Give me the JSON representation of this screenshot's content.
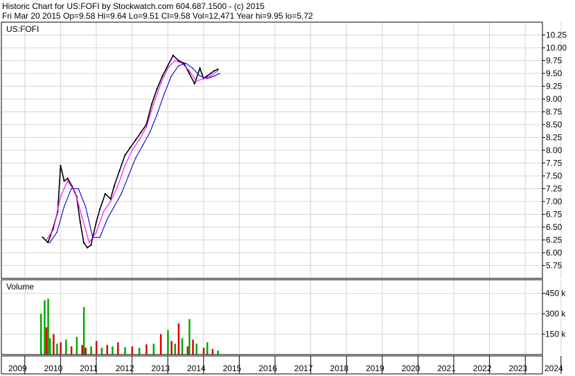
{
  "header": {
    "line1": "Historic Chart for US:FOFI by Stockwatch.com 604.687.1500 - (c) 2015",
    "line2": "Fri Mar 20 2015   Op=9.58  Hi=9.64  Lo=9.51  Cl=9.58  Vol=12,471  Year hi=9.95  lo=5.72"
  },
  "chart_data": [
    {
      "type": "line",
      "title": "US:FOFI",
      "x_years": [
        "2009",
        "2010",
        "2011",
        "2012",
        "2013",
        "2014",
        "2015",
        "2016",
        "2017",
        "2018",
        "2019",
        "2020",
        "2021",
        "2022",
        "2023",
        "2024"
      ],
      "y_ticks": [
        5.75,
        6.0,
        6.25,
        6.5,
        6.75,
        7.0,
        7.25,
        7.5,
        7.75,
        8.0,
        8.25,
        8.5,
        8.75,
        9.0,
        9.25,
        9.5,
        9.75,
        10.0,
        10.25
      ],
      "ylim": [
        5.5,
        10.5
      ],
      "series": [
        {
          "color": "#000000",
          "x": [
            2010.0,
            2010.15,
            2010.3,
            2010.42,
            2010.5,
            2010.6,
            2010.7,
            2010.82,
            2010.95,
            2011.05,
            2011.15,
            2011.25,
            2011.35,
            2011.5,
            2011.6,
            2011.75,
            2011.9,
            2012.0,
            2012.15,
            2012.3,
            2012.45,
            2012.6,
            2012.75,
            2012.9,
            2013.05,
            2013.2,
            2013.35,
            2013.5,
            2013.65,
            2013.8,
            2013.95,
            2014.1,
            2014.25,
            2014.4,
            2014.5,
            2014.6,
            2014.7,
            2014.8,
            2014.9
          ],
          "values": [
            6.3,
            6.2,
            6.5,
            6.8,
            7.7,
            7.4,
            7.45,
            7.3,
            7.1,
            6.6,
            6.2,
            6.1,
            6.15,
            6.6,
            6.85,
            7.15,
            7.05,
            7.3,
            7.6,
            7.9,
            8.05,
            8.2,
            8.35,
            8.5,
            8.9,
            9.2,
            9.45,
            9.65,
            9.85,
            9.75,
            9.7,
            9.5,
            9.3,
            9.6,
            9.4,
            9.45,
            9.5,
            9.55,
            9.58
          ]
        },
        {
          "color": "#ff00ff",
          "x": [
            2010.1,
            2010.3,
            2010.5,
            2010.7,
            2010.9,
            2011.1,
            2011.3,
            2011.5,
            2011.7,
            2011.9,
            2012.1,
            2012.3,
            2012.5,
            2012.7,
            2012.9,
            2013.1,
            2013.3,
            2013.5,
            2013.7,
            2013.9,
            2014.1,
            2014.3,
            2014.5,
            2014.7,
            2014.9
          ],
          "values": [
            6.25,
            6.45,
            7.1,
            7.4,
            7.2,
            6.7,
            6.2,
            6.4,
            6.8,
            7.0,
            7.3,
            7.7,
            8.0,
            8.2,
            8.45,
            8.9,
            9.3,
            9.6,
            9.75,
            9.7,
            9.55,
            9.35,
            9.4,
            9.45,
            9.55
          ]
        },
        {
          "color": "#0000cc",
          "x": [
            2010.2,
            2010.4,
            2010.6,
            2010.8,
            2011.0,
            2011.2,
            2011.4,
            2011.6,
            2011.8,
            2012.0,
            2012.2,
            2012.4,
            2012.6,
            2012.8,
            2013.0,
            2013.2,
            2013.4,
            2013.6,
            2013.8,
            2014.0,
            2014.2,
            2014.4,
            2014.6,
            2014.8,
            2014.95
          ],
          "values": [
            6.2,
            6.4,
            6.9,
            7.25,
            7.25,
            6.9,
            6.3,
            6.3,
            6.65,
            6.9,
            7.15,
            7.5,
            7.85,
            8.1,
            8.35,
            8.7,
            9.1,
            9.45,
            9.65,
            9.7,
            9.6,
            9.45,
            9.4,
            9.45,
            9.5
          ]
        }
      ]
    },
    {
      "type": "bar",
      "title": "Volume",
      "y_ticks": [
        "150 k",
        "300 k",
        "450 k"
      ],
      "y_tick_values": [
        150000,
        300000,
        450000
      ],
      "ylim": [
        0,
        550000
      ],
      "x": [
        2009.95,
        2010.05,
        2010.1,
        2010.15,
        2010.2,
        2010.3,
        2010.4,
        2010.5,
        2010.65,
        2010.8,
        2010.95,
        2011.1,
        2011.15,
        2011.2,
        2011.35,
        2011.5,
        2011.65,
        2011.8,
        2011.95,
        2012.1,
        2012.3,
        2012.5,
        2012.7,
        2012.9,
        2013.1,
        2013.3,
        2013.5,
        2013.6,
        2013.7,
        2013.8,
        2013.9,
        2014.05,
        2014.1,
        2014.2,
        2014.3,
        2014.5,
        2014.6,
        2014.75,
        2014.9
      ],
      "values": [
        300000,
        400000,
        200000,
        410000,
        120000,
        150000,
        80000,
        90000,
        110000,
        60000,
        130000,
        70000,
        350000,
        50000,
        60000,
        100000,
        50000,
        70000,
        60000,
        90000,
        55000,
        60000,
        50000,
        75000,
        80000,
        150000,
        180000,
        100000,
        80000,
        230000,
        120000,
        60000,
        260000,
        110000,
        80000,
        50000,
        90000,
        40000,
        30000
      ],
      "colors": [
        "#00aa00",
        "#00aa00",
        "#dd0000",
        "#00aa00",
        "#00aa00",
        "#dd0000",
        "#00aa00",
        "#dd0000",
        "#00aa00",
        "#dd0000",
        "#00aa00",
        "#dd0000",
        "#00aa00",
        "#dd0000",
        "#00aa00",
        "#dd0000",
        "#00aa00",
        "#dd0000",
        "#00aa00",
        "#dd0000",
        "#00aa00",
        "#dd0000",
        "#00aa00",
        "#dd0000",
        "#00aa00",
        "#dd0000",
        "#00aa00",
        "#dd0000",
        "#00aa00",
        "#dd0000",
        "#00aa00",
        "#dd0000",
        "#00aa00",
        "#dd0000",
        "#00aa00",
        "#dd0000",
        "#00aa00",
        "#dd0000",
        "#00aa00"
      ]
    }
  ]
}
